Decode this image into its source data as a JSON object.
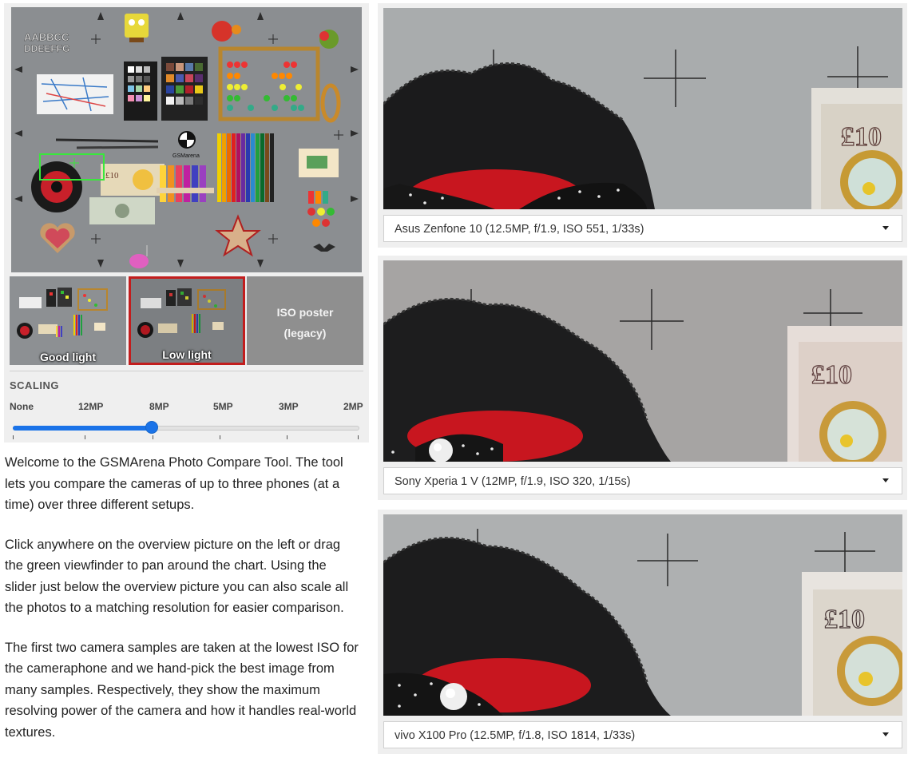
{
  "overview": {
    "chart_letters_line1": "AABBCC",
    "chart_letters_line2": "DDEEFFG",
    "chart_brand": "GSMarena",
    "banknote_symbol": "£10"
  },
  "thumbnails": [
    {
      "label": "Good light",
      "selected": false
    },
    {
      "label": "Low light",
      "selected": true
    },
    {
      "label_line1": "ISO poster",
      "label_line2": "(legacy)",
      "selected": false
    }
  ],
  "scaling": {
    "title": "SCALING",
    "options": [
      "None",
      "12MP",
      "8MP",
      "5MP",
      "3MP",
      "2MP"
    ],
    "selected": "8MP",
    "selected_fraction": 0.4
  },
  "description": {
    "paragraphs": [
      "Welcome to the GSMArena Photo Compare Tool. The tool lets you compare the cameras of up to three phones (at a time) over three different setups.",
      "Click anywhere on the overview picture on the left or drag the green viewfinder to pan around the chart. Using the slider just below the overview picture you can also scale all the photos to a matching resolution for easier comparison.",
      "The first two camera samples are taken at the lowest ISO for the cameraphone and we hand-pick the best image from many samples. Respectively, they show the maximum resolving power of the camera and how it handles real-world textures."
    ]
  },
  "comparisons": [
    {
      "phone": "Asus Zenfone 10 (12.5MP, f/1.9, ISO 551, 1/33s)",
      "banknote": "£10"
    },
    {
      "phone": "Sony Xperia 1 V (12MP, f/1.9, ISO 320, 1/15s)",
      "banknote": "£10"
    },
    {
      "phone": "vivo X100 Pro (12.5MP, f/1.8, ISO 1814, 1/33s)",
      "banknote": "£10"
    }
  ],
  "colors": {
    "accent_blue": "#1a73e8",
    "viewfinder_green": "#39e83b",
    "selected_border_red": "#c21d1d"
  }
}
